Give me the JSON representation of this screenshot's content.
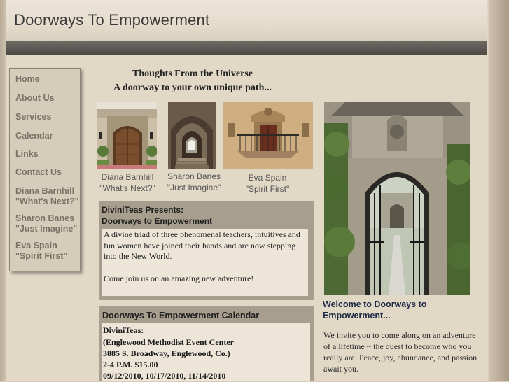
{
  "site": {
    "title": "Doorways To Empowerment"
  },
  "nav": {
    "items": [
      {
        "label": "Home"
      },
      {
        "label": "About Us"
      },
      {
        "label": "Services"
      },
      {
        "label": "Calendar"
      },
      {
        "label": "Links"
      },
      {
        "label": "Contact Us"
      },
      {
        "label": "Diana Barnhill",
        "sub": "\"What's Next?\""
      },
      {
        "label": "Sharon Banes",
        "sub": "\"Just Imagine\""
      },
      {
        "label": "Eva Spain",
        "sub": "\"Spirit First\""
      }
    ]
  },
  "tagline": {
    "line1": "Thoughts From the Universe",
    "line2": "A doorway to your own unique path..."
  },
  "teachers": [
    {
      "name": "Diana Barnhill",
      "motto": "\"What's Next?\""
    },
    {
      "name": "Sharon Banes",
      "motto": "\"Just Imagine\""
    },
    {
      "name": "Eva Spain",
      "motto": "\"Spirit First\""
    }
  ],
  "intro_panel": {
    "title_line1": "DiviniTeas Presents:",
    "title_line2": "Doorways to Empowerment",
    "paragraph1": "A divine triad of three phenomenal teachers, intuitives and fun women have joined their hands and are now stepping into the New World.",
    "paragraph2": "Come join us on an amazing new adventure!"
  },
  "calendar_panel": {
    "title": "Doorways To Empowerment Calendar",
    "lines": [
      "DiviniTeas:",
      "(Englewood Methodist Event Center",
      "3885 S. Broadway, Englewood, Co.)",
      "2-4 P.M. $15.00",
      "09/12/2010, 10/17/2010, 11/14/2010"
    ]
  },
  "welcome": {
    "title_line1": "Welcome to Doorways to",
    "title_line2": "Empowerment...",
    "body": "We invite you to come along on an adventure of a lifetime ~ the quest to become who you really are. Peace, joy, abundance, and passion await you."
  }
}
